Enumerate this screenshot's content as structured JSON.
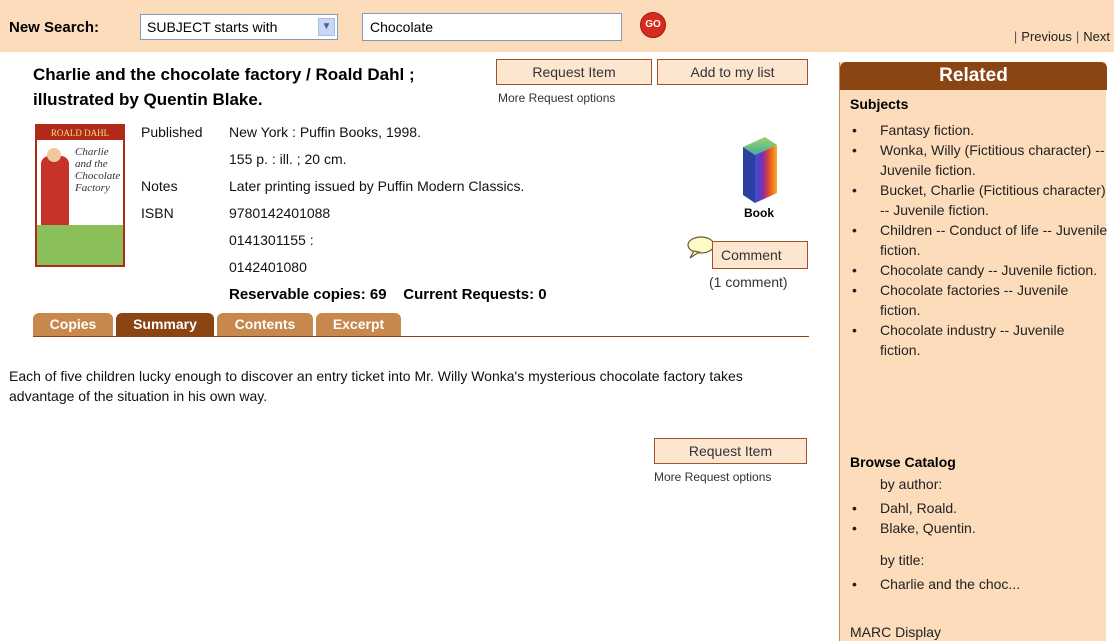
{
  "search": {
    "label": "New Search:",
    "select_value": "SUBJECT starts with",
    "query": "Chocolate",
    "go_label": "GO",
    "prev_label": "Previous",
    "next_label": "Next"
  },
  "book": {
    "title": "Charlie and the chocolate factory / Roald Dahl ; illustrated by Quentin Blake.",
    "request_label": "Request Item",
    "add_list_label": "Add to my list",
    "more_request": "More Request options",
    "cover_header": "ROALD DAHL",
    "cover_title": "Charlie and the Chocolate Factory",
    "published_label": "Published",
    "published": "New York : Puffin Books, 1998.",
    "physical": "155 p. : ill. ; 20 cm.",
    "notes_label": "Notes",
    "notes": "Later printing issued by Puffin Modern Classics.",
    "isbn_label": "ISBN",
    "isbn": [
      "9780142401088",
      "0141301155 :",
      "0142401080"
    ],
    "format_label": "Book",
    "comment_label": "Comment",
    "comment_count": "(1 comment)",
    "reservable": "Reservable copies: 69    Current Requests: 0"
  },
  "tabs": [
    "Copies",
    "Summary",
    "Contents",
    "Excerpt"
  ],
  "active_tab": "Summary",
  "summary_text": "Each of five children lucky enough to discover an entry ticket into Mr. Willy Wonka's mysterious chocolate factory takes advantage of the situation in his own way.",
  "bottom": {
    "request_label": "Request Item",
    "more_request": "More Request options"
  },
  "related": {
    "heading": "Related",
    "subjects_heading": "Subjects",
    "subjects": [
      "Fantasy fiction.",
      "Wonka, Willy (Fictitious character) -- Juvenile fiction.",
      "Bucket, Charlie (Fictitious character) -- Juvenile fiction.",
      "Children -- Conduct of life -- Juvenile fiction.",
      "Chocolate candy -- Juvenile fiction.",
      "Chocolate factories -- Juvenile fiction.",
      "Chocolate industry -- Juvenile fiction."
    ],
    "browse_heading": "Browse Catalog",
    "by_author_label": "by author:",
    "authors": [
      "Dahl, Roald.",
      "Blake, Quentin."
    ],
    "by_title_label": "by title:",
    "titles": [
      "Charlie and the choc..."
    ],
    "marc_label": "MARC Display"
  },
  "colors": {
    "band": "#fcdcbb",
    "brown": "#8b4513",
    "tab": "#c8874c",
    "go": "#d62b1f"
  }
}
